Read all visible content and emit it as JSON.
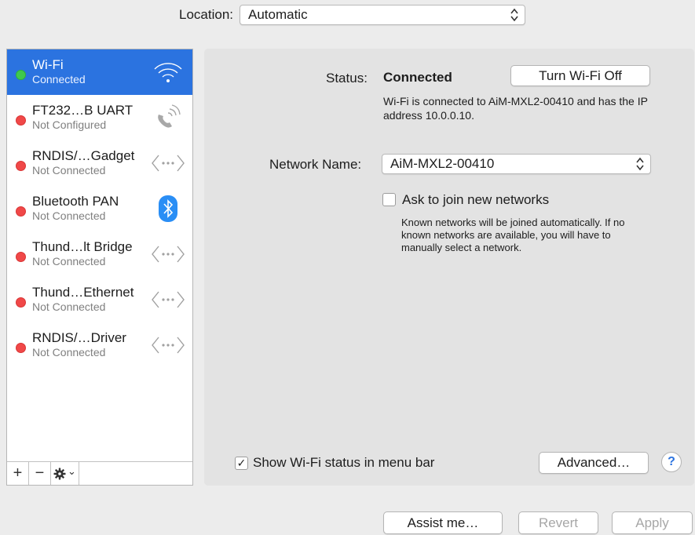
{
  "location": {
    "label": "Location:",
    "value": "Automatic"
  },
  "services": [
    {
      "name": "Wi-Fi",
      "status": "Connected",
      "dot": "green",
      "icon": "wifi-icon",
      "selected": true
    },
    {
      "name": "FT232…B UART",
      "status": "Not Configured",
      "dot": "red",
      "icon": "phone-icon",
      "selected": false
    },
    {
      "name": "RNDIS/…Gadget",
      "status": "Not Connected",
      "dot": "red",
      "icon": "ethernet-icon",
      "selected": false
    },
    {
      "name": "Bluetooth PAN",
      "status": "Not Connected",
      "dot": "red",
      "icon": "bluetooth-icon",
      "selected": false
    },
    {
      "name": "Thund…lt Bridge",
      "status": "Not Connected",
      "dot": "red",
      "icon": "ethernet-icon",
      "selected": false
    },
    {
      "name": "Thund…Ethernet",
      "status": "Not Connected",
      "dot": "red",
      "icon": "ethernet-icon",
      "selected": false
    },
    {
      "name": "RNDIS/…Driver",
      "status": "Not Connected",
      "dot": "red",
      "icon": "ethernet-icon",
      "selected": false
    }
  ],
  "sidebar_bar": {
    "add": "+",
    "remove": "−",
    "gear_chevron": "⌄"
  },
  "detail": {
    "status_label": "Status:",
    "status_value": "Connected",
    "turn_off_button": "Turn Wi-Fi Off",
    "status_description": "Wi-Fi is connected to AiM-MXL2-00410 and has the IP address 10.0.0.10.",
    "network_name_label": "Network Name:",
    "network_name_value": "AiM-MXL2-00410",
    "ask_to_join_label": "Ask to join new networks",
    "ask_to_join_checked": false,
    "ask_to_join_description": "Known networks will be joined automatically. If no known networks are available, you will have to manually select a network.",
    "show_status_label": "Show Wi-Fi status in menu bar",
    "show_status_mark": "✓",
    "advanced_button": "Advanced…",
    "help_button": "?"
  },
  "footer": {
    "assist_button": "Assist me…",
    "revert_button": "Revert",
    "apply_button": "Apply"
  },
  "colors": {
    "selection": "#2b73e0",
    "connected_dot": "#3fc94e",
    "disconnected_dot": "#f04848",
    "bluetooth_badge": "#2a8ef5"
  }
}
